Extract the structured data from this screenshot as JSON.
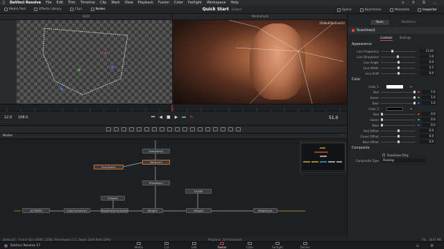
{
  "menubar": {
    "app_name": "DaVinci Resolve",
    "items": [
      "File",
      "Edit",
      "Trim",
      "Timeline",
      "Clip",
      "Mark",
      "View",
      "Playback",
      "Fusion",
      "Color",
      "Fairlight",
      "Workspace",
      "Help"
    ],
    "time": "..."
  },
  "toolbar": {
    "left_items": [
      "Media Pool",
      "Effects Library",
      "Clips",
      "Nodes"
    ],
    "project_title": "Quick Start",
    "project_state": "Edited",
    "right_items": [
      "Spline",
      "Keyframes",
      "Metadata",
      "Inspector"
    ]
  },
  "viewers": {
    "left_label": "HUD",
    "right_label": "MediaOut1",
    "right_info": "2048x858xfloat32"
  },
  "transport": {
    "start": "12.0",
    "end": "108.0",
    "current": "51.0"
  },
  "nodes_panel": {
    "title": "Nodes",
    "nodes": [
      "Transform1",
      "Defocus1",
      "Scanlines1",
      "PrismBlur1",
      "GLASS",
      "Ellipse1",
      "ACTRESS",
      "ColorCorrector1",
      "BrightnessContrast1",
      "Merge1",
      "Merge2",
      "MediaOut1"
    ]
  },
  "inspector": {
    "tabs": [
      "Tools",
      "Modifiers"
    ],
    "tool_name": "Scanlines1",
    "subtabs": [
      "Controls",
      "Settings"
    ],
    "appearance": {
      "title": "Appearance",
      "rows": [
        {
          "label": "Line Frequency",
          "value": "11.02"
        },
        {
          "label": "Line Sharpness",
          "value": "1.0"
        },
        {
          "label": "Line Angle",
          "value": "0.0"
        },
        {
          "label": "Line Width",
          "value": "0.5"
        },
        {
          "label": "Line Shift",
          "value": "0.0"
        }
      ]
    },
    "color": {
      "title": "Color",
      "color1_label": "Color 1",
      "color1_rows": [
        {
          "label": "Red",
          "value": "1.0"
        },
        {
          "label": "Green",
          "value": "1.0"
        },
        {
          "label": "Blue",
          "value": "1.0"
        }
      ],
      "color2_label": "Color 2",
      "color2_rows": [
        {
          "label": "Red",
          "value": "0.0"
        },
        {
          "label": "Green",
          "value": "0.0"
        },
        {
          "label": "Blue",
          "value": "0.0"
        },
        {
          "label": "Red Offset",
          "value": "0.0"
        },
        {
          "label": "Green Offset",
          "value": "0.0"
        },
        {
          "label": "Blue Offset",
          "value": "0.0"
        }
      ]
    },
    "composite": {
      "title": "Composite",
      "scanlines_only": "Scanlines Only",
      "type_label": "Composite Type",
      "type_value": "Overlay"
    }
  },
  "statusbar": {
    "left": "Defocus1 - Frame Size (2560, 1558), Pixel Aspect 1:1, Depth 32bit float (GPU)",
    "center": "Playback: 24 frames/sec",
    "right": "5% - 3547 MB"
  },
  "pages": {
    "app_label": "DaVinci Resolve 17",
    "items": [
      "Media",
      "Cut",
      "Edit",
      "Fusion",
      "Color",
      "Fairlight",
      "Deliver"
    ],
    "active": "Fusion"
  }
}
